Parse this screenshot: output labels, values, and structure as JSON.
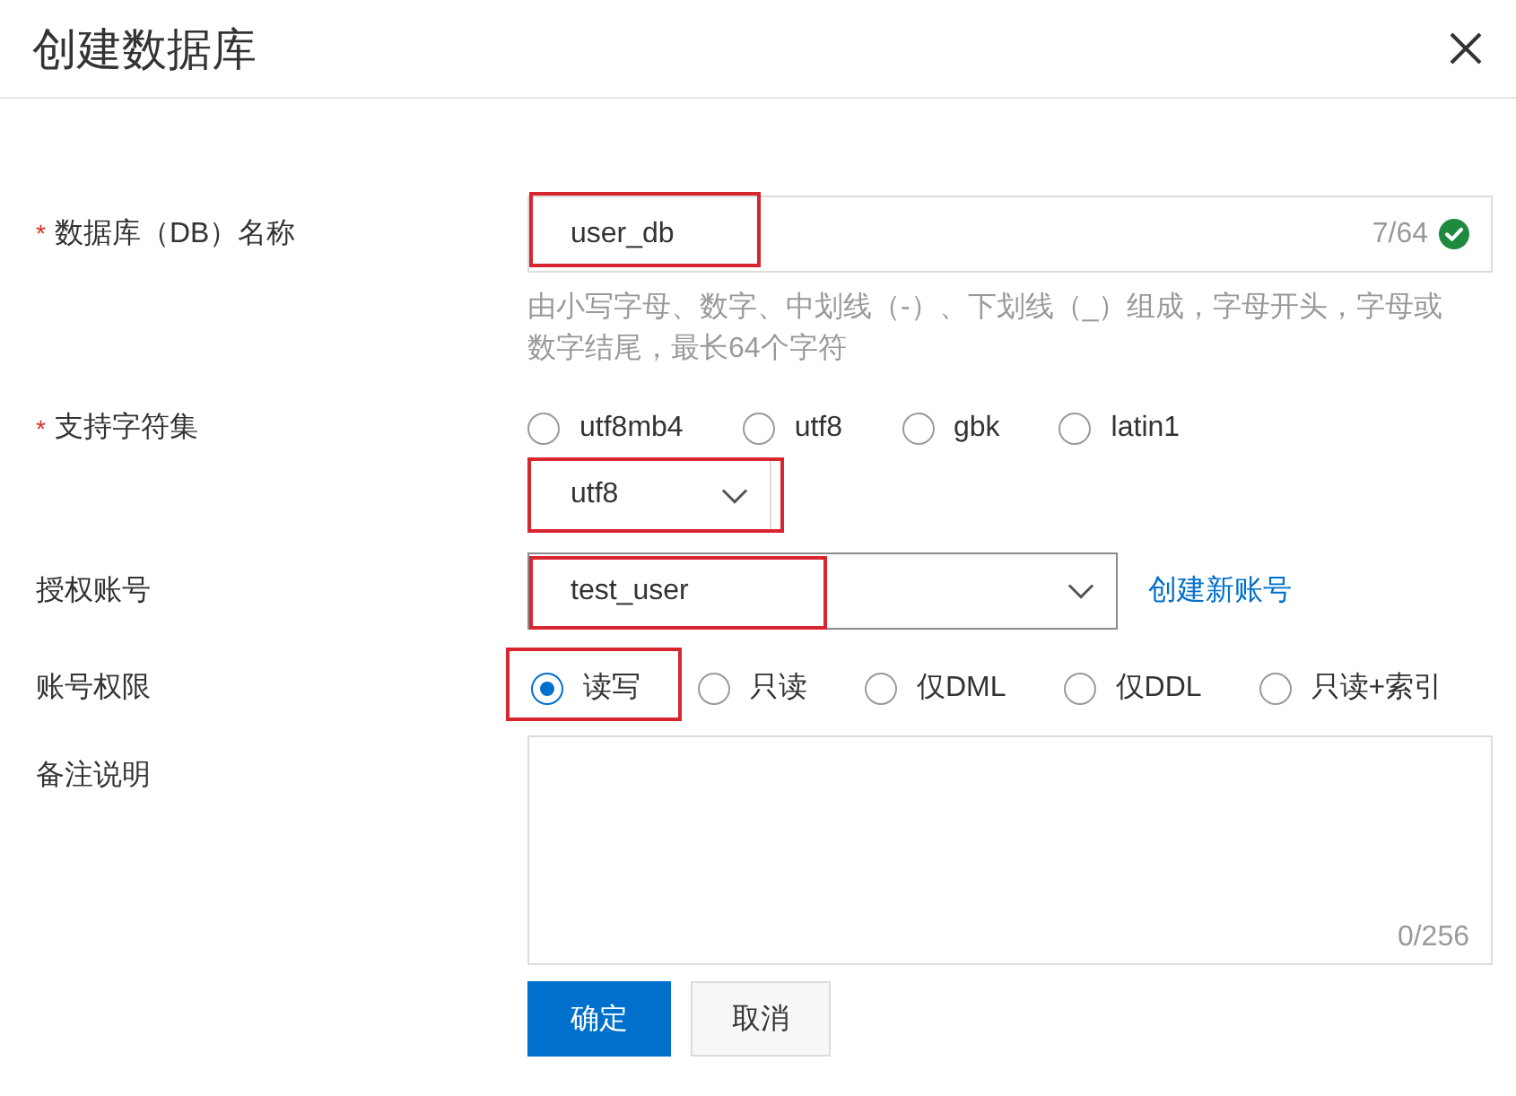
{
  "dialog": {
    "title": "创建数据库"
  },
  "fields": [
    {
      "kind": "text",
      "required_mark": "*",
      "label": "数据库（DB）名称",
      "value": "user_db",
      "counter": "7/64",
      "valid": true,
      "highlighted": true,
      "help": "由小写字母、数字、中划线（-）、下划线（_）组成，字母开头，字母或数字结尾，最长64个字符"
    },
    {
      "kind": "charset",
      "required_mark": "*",
      "label": "支持字符集",
      "options": [
        {
          "label": "utf8mb4",
          "selected": false
        },
        {
          "label": "utf8",
          "selected": false
        },
        {
          "label": "gbk",
          "selected": false
        },
        {
          "label": "latin1",
          "selected": false
        }
      ],
      "select": {
        "value": "utf8",
        "highlighted": true
      }
    },
    {
      "kind": "select",
      "label": "授权账号",
      "value": "test_user",
      "highlighted": true,
      "link": "创建新账号"
    },
    {
      "kind": "radio",
      "label": "账号权限",
      "options": [
        {
          "label": "读写",
          "selected": true,
          "highlighted": true
        },
        {
          "label": "只读",
          "selected": false,
          "highlighted": false
        },
        {
          "label": "仅DML",
          "selected": false,
          "highlighted": false
        },
        {
          "label": "仅DDL",
          "selected": false,
          "highlighted": false
        },
        {
          "label": "只读+索引",
          "selected": false,
          "highlighted": false
        }
      ]
    },
    {
      "kind": "textarea",
      "label": "备注说明",
      "counter": "0/256"
    }
  ],
  "buttons": [
    {
      "label": "确定",
      "kind": "primary"
    },
    {
      "label": "取消",
      "kind": "default"
    }
  ]
}
